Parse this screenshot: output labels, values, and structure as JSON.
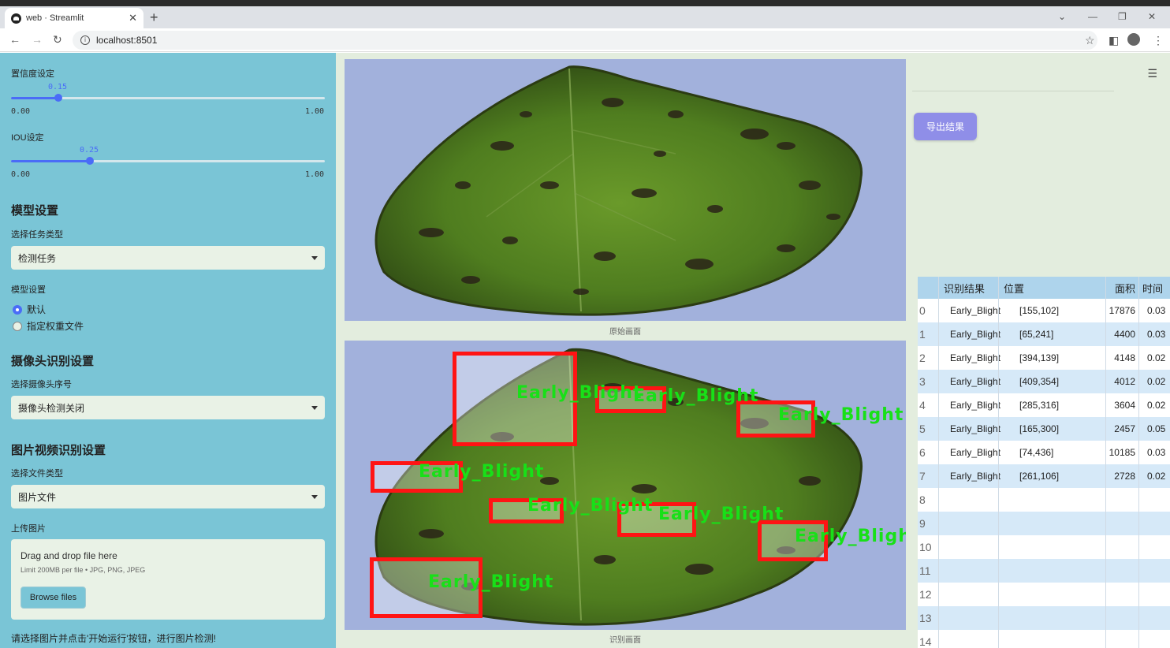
{
  "browser": {
    "tab_title": "web · Streamlit",
    "url": "localhost:8501"
  },
  "sidebar": {
    "conf_label": "置信度设定",
    "conf_value": "0.15",
    "conf_fraction": 0.15,
    "conf_min": "0.00",
    "conf_max": "1.00",
    "iou_label": "IOU设定",
    "iou_value": "0.25",
    "iou_fraction": 0.25,
    "iou_min": "0.00",
    "iou_max": "1.00",
    "model_section": "模型设置",
    "task_label": "选择任务类型",
    "task_value": "检测任务",
    "model_label": "模型设置",
    "model_options": [
      "默认",
      "指定权重文件"
    ],
    "model_selected": "默认",
    "camera_section": "摄像头识别设置",
    "camera_label": "选择摄像头序号",
    "camera_value": "摄像头检测关闭",
    "media_section": "图片视频识别设置",
    "filetype_label": "选择文件类型",
    "filetype_value": "图片文件",
    "upload_label": "上传图片",
    "drop_text": "Drag and drop file here",
    "limit_text": "Limit 200MB per file • JPG, PNG, JPEG",
    "browse_label": "Browse files",
    "hint": "请选择图片并点击'开始运行'按钮，进行图片检测!"
  },
  "main": {
    "original_caption": "原始画面",
    "result_caption": "识别画面",
    "export_label": "导出结果",
    "detection_label": "Early_Blight"
  },
  "table": {
    "headers": [
      "识别结果",
      "位置",
      "面积",
      "时间"
    ],
    "rows": [
      {
        "idx": "0",
        "result": "Early_Blight",
        "pos": "[155,102]",
        "area": "17876",
        "time": "0.03"
      },
      {
        "idx": "1",
        "result": "Early_Blight",
        "pos": "[65,241]",
        "area": "4400",
        "time": "0.03"
      },
      {
        "idx": "2",
        "result": "Early_Blight",
        "pos": "[394,139]",
        "area": "4148",
        "time": "0.02"
      },
      {
        "idx": "3",
        "result": "Early_Blight",
        "pos": "[409,354]",
        "area": "4012",
        "time": "0.02"
      },
      {
        "idx": "4",
        "result": "Early_Blight",
        "pos": "[285,316]",
        "area": "3604",
        "time": "0.02"
      },
      {
        "idx": "5",
        "result": "Early_Blight",
        "pos": "[165,300]",
        "area": "2457",
        "time": "0.05"
      },
      {
        "idx": "6",
        "result": "Early_Blight",
        "pos": "[74,436]",
        "area": "10185",
        "time": "0.03"
      },
      {
        "idx": "7",
        "result": "Early_Blight",
        "pos": "[261,106]",
        "area": "2728",
        "time": "0.02"
      },
      {
        "idx": "8",
        "result": "",
        "pos": "",
        "area": "",
        "time": ""
      },
      {
        "idx": "9",
        "result": "",
        "pos": "",
        "area": "",
        "time": ""
      },
      {
        "idx": "10",
        "result": "",
        "pos": "",
        "area": "",
        "time": ""
      },
      {
        "idx": "11",
        "result": "",
        "pos": "",
        "area": "",
        "time": ""
      },
      {
        "idx": "12",
        "result": "",
        "pos": "",
        "area": "",
        "time": ""
      },
      {
        "idx": "13",
        "result": "",
        "pos": "",
        "area": "",
        "time": ""
      },
      {
        "idx": "14",
        "result": "",
        "pos": "",
        "area": "",
        "time": ""
      }
    ]
  },
  "colors": {
    "sidebar_bg": "#7ac5d6",
    "accent": "#4a6cf7",
    "export_btn": "#8f8ee8",
    "bbox": "#ff1414",
    "bbox_label": "#18e018"
  }
}
